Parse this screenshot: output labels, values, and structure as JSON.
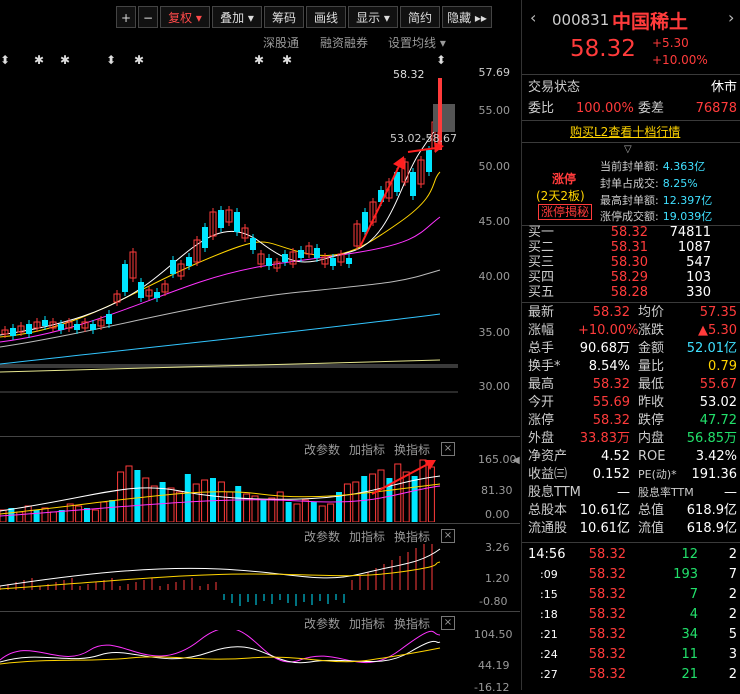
{
  "toolbar": {
    "buttons": [
      "+",
      "−",
      "复权 ▾",
      "叠加 ▾",
      "筹码",
      "画线",
      "显示 ▾",
      "简约",
      "隐藏 ▸▸"
    ]
  },
  "subbar": {
    "items": [
      "深股通",
      "融资融券",
      "设置均线 ▾"
    ]
  },
  "price_axis": [
    "57.69",
    "55.00",
    "50.00",
    "45.00",
    "40.00",
    "35.00",
    "30.00"
  ],
  "price_labels": {
    "high_tag": "58.32",
    "range_tag": "53.02-58.67"
  },
  "vol_panel": {
    "axis": [
      "165.00",
      "81.30",
      "0.00"
    ],
    "actions": [
      "改参数",
      "加指标",
      "换指标"
    ]
  },
  "macd_panel": {
    "axis": [
      "3.26",
      "1.20",
      "-0.80"
    ],
    "actions": [
      "改参数",
      "加指标",
      "换指标"
    ]
  },
  "kdj_panel": {
    "axis": [
      "104.50",
      "44.19",
      "-16.12"
    ],
    "actions": [
      "改参数",
      "加指标",
      "换指标"
    ]
  },
  "stock": {
    "code": "000831",
    "name": "中国稀土",
    "price": "58.32",
    "change": "+5.30",
    "change_pct": "+10.00%",
    "status_label": "交易状态",
    "status": "休市",
    "wb_label": "委比",
    "wb": "100.00%",
    "wc_label": "委差",
    "wc": "76878",
    "l2_link": "购买L2查看十档行情"
  },
  "limit_up": {
    "tag": "涨停",
    "boards": "(2天2板)",
    "secret": "涨停揭秘",
    "lines": [
      {
        "k": "当前封单额:",
        "v": "4.363亿"
      },
      {
        "k": "封单占成交:",
        "v": "8.25%"
      },
      {
        "k": "最高封单额:",
        "v": "12.397亿"
      },
      {
        "k": "涨停成交额:",
        "v": "19.039亿"
      }
    ]
  },
  "bids": [
    {
      "name": "买一",
      "price": "58.32",
      "vol": "74811"
    },
    {
      "name": "买二",
      "price": "58.31",
      "vol": "1087"
    },
    {
      "name": "买三",
      "price": "58.30",
      "vol": "547"
    },
    {
      "name": "买四",
      "price": "58.29",
      "vol": "103"
    },
    {
      "name": "买五",
      "price": "58.28",
      "vol": "330"
    }
  ],
  "stats": [
    {
      "k1": "最新",
      "v1": "58.32",
      "c1": "red",
      "k2": "均价",
      "v2": "57.35",
      "c2": "red"
    },
    {
      "k1": "涨幅",
      "v1": "+10.00%",
      "c1": "red",
      "k2": "涨跌",
      "v2": "▲5.30",
      "c2": "red"
    },
    {
      "k1": "总手",
      "v1": "90.68万",
      "c1": "white",
      "k2": "金额",
      "v2": "52.01亿",
      "c2": "cyan"
    },
    {
      "k1": "换手*",
      "v1": "8.54%",
      "c1": "white",
      "k2": "量比",
      "v2": "0.79",
      "c2": "yellow"
    },
    {
      "k1": "最高",
      "v1": "58.32",
      "c1": "red",
      "k2": "最低",
      "v2": "55.67",
      "c2": "red"
    },
    {
      "k1": "今开",
      "v1": "55.69",
      "c1": "red",
      "k2": "昨收",
      "v2": "53.02",
      "c2": "white"
    },
    {
      "k1": "涨停",
      "v1": "58.32",
      "c1": "red",
      "k2": "跌停",
      "v2": "47.72",
      "c2": "green"
    },
    {
      "k1": "外盘",
      "v1": "33.83万",
      "c1": "red",
      "k2": "内盘",
      "v2": "56.85万",
      "c2": "green"
    },
    {
      "k1": "净资产",
      "v1": "4.52",
      "c1": "white",
      "k2": "ROE",
      "v2": "3.42%",
      "c2": "white"
    },
    {
      "k1": "收益㈢",
      "v1": "0.152",
      "c1": "white",
      "k2": "PE(动)*",
      "v2": "191.36",
      "c2": "white"
    },
    {
      "k1": "股息TTM",
      "v1": "—",
      "c1": "white",
      "k2": "股息率TTM",
      "v2": "—",
      "c2": "white"
    },
    {
      "k1": "总股本",
      "v1": "10.61亿",
      "c1": "white",
      "k2": "总值",
      "v2": "618.9亿",
      "c2": "white"
    },
    {
      "k1": "流通股",
      "v1": "10.61亿",
      "c1": "white",
      "k2": "流值",
      "v2": "618.9亿",
      "c2": "white"
    }
  ],
  "ticks": [
    {
      "t": "14:56",
      "p": "58.32",
      "v": "12",
      "n": "2"
    },
    {
      "t": ":09",
      "p": "58.32",
      "v": "193",
      "n": "7"
    },
    {
      "t": ":15",
      "p": "58.32",
      "v": "7",
      "n": "2"
    },
    {
      "t": ":18",
      "p": "58.32",
      "v": "4",
      "n": "2"
    },
    {
      "t": ":21",
      "p": "58.32",
      "v": "34",
      "n": "5"
    },
    {
      "t": ":24",
      "p": "58.32",
      "v": "11",
      "n": "3"
    },
    {
      "t": ":27",
      "p": "58.32",
      "v": "21",
      "n": "2"
    }
  ],
  "colors": {
    "up": "#ff3b3b",
    "down": "#00e5ff",
    "ma5": "#ffffff",
    "ma10": "#ffd400",
    "ma20": "#ff33ff",
    "ma60": "#cfcfcf"
  }
}
